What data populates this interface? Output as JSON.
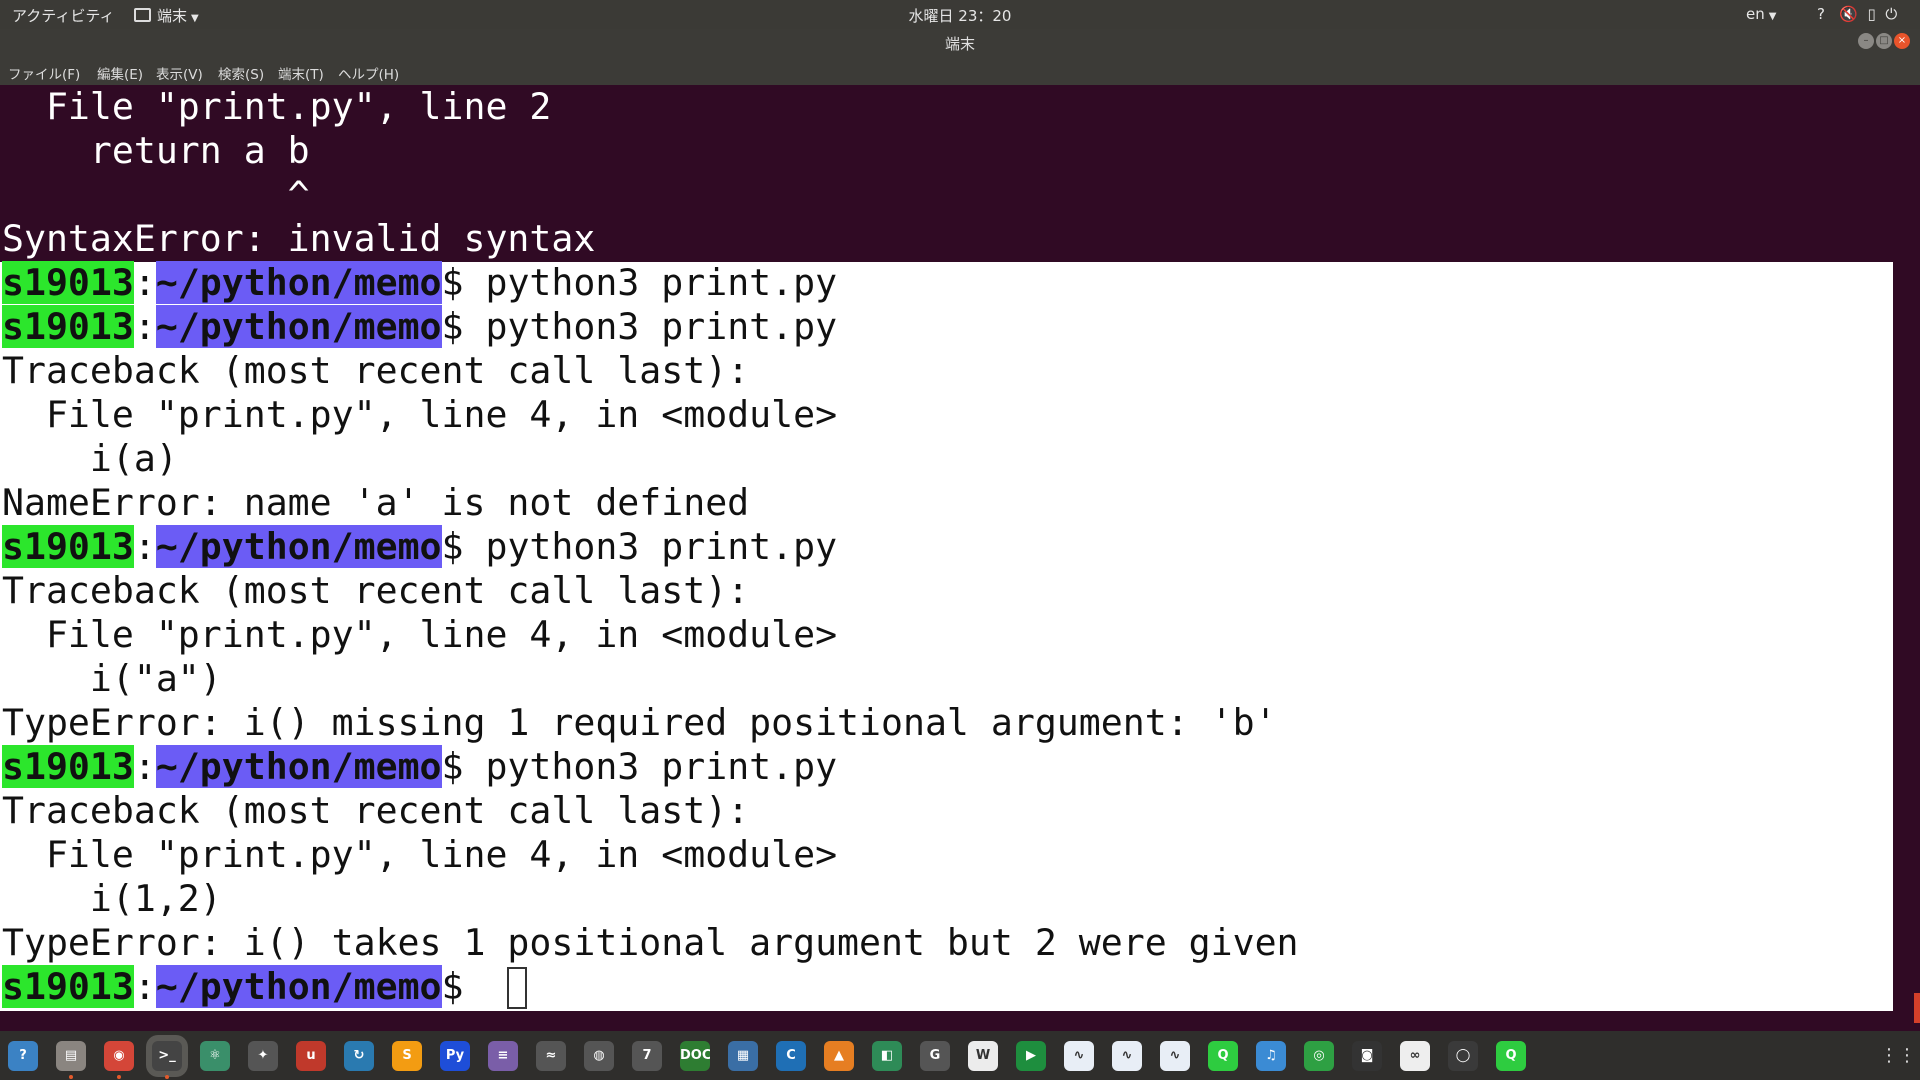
{
  "topbar": {
    "activities": "アクティビティ",
    "app_name": "端末",
    "clock": "水曜日 23：20",
    "language": "en",
    "tray_icons": [
      "help-icon",
      "volume-muted-icon",
      "battery-icon",
      "power-icon"
    ]
  },
  "window": {
    "title": "端末",
    "controls": [
      "minimize",
      "maximize",
      "close"
    ]
  },
  "menu": {
    "file": "ファイル(F)",
    "edit": "編集(E)",
    "view": "表示(V)",
    "search": "検索(S)",
    "terminal": "端末(T)",
    "help": "ヘルプ(H)"
  },
  "terminal": {
    "prompt_user": "s19013",
    "prompt_sep": ":",
    "prompt_path": "~/python/memo",
    "prompt_sign": "$ ",
    "lines": [
      {
        "text": "  File \"print.py\", line 2"
      },
      {
        "text": "    return a b"
      },
      {
        "text": "             ^"
      },
      {
        "text": "SyntaxError: invalid syntax"
      },
      {
        "cmd": "python3 print.py"
      },
      {
        "cmd": "python3 print.py"
      },
      {
        "text": "Traceback (most recent call last):"
      },
      {
        "text": "  File \"print.py\", line 4, in <module>"
      },
      {
        "text": "    i(a)"
      },
      {
        "text": "NameError: name 'a' is not defined"
      },
      {
        "cmd": "python3 print.py"
      },
      {
        "text": "Traceback (most recent call last):"
      },
      {
        "text": "  File \"print.py\", line 4, in <module>"
      },
      {
        "text": "    i(\"a\")"
      },
      {
        "text": "TypeError: i() missing 1 required positional argument: 'b'"
      },
      {
        "cmd": "python3 print.py"
      },
      {
        "text": "Traceback (most recent call last):"
      },
      {
        "text": "  File \"print.py\", line 4, in <module>"
      },
      {
        "text": "    i(1,2)"
      },
      {
        "text": "TypeError: i() takes 1 positional argument but 2 were given"
      },
      {
        "cmd": ""
      }
    ]
  },
  "dock": {
    "apps": [
      {
        "name": "help-app",
        "label": "?",
        "color": "#3b82c4"
      },
      {
        "name": "file-manager-app",
        "label": "▤",
        "color": "#8a8580",
        "running": true
      },
      {
        "name": "chrome-app",
        "label": "◉",
        "color": "#d44638",
        "running": true
      },
      {
        "name": "terminal-app",
        "label": ">_",
        "color": "#444",
        "running": true,
        "active": true
      },
      {
        "name": "atom-app",
        "label": "⚛",
        "color": "#3a8f6a"
      },
      {
        "name": "sourcetree-app",
        "label": "✦",
        "color": "#555"
      },
      {
        "name": "text-app",
        "label": "u",
        "color": "#c0392b"
      },
      {
        "name": "update-app",
        "label": "↻",
        "color": "#2a7ab0"
      },
      {
        "name": "sublime-app",
        "label": "S",
        "color": "#f39c12"
      },
      {
        "name": "pycharm-app",
        "label": "Py",
        "color": "#1e4ed8"
      },
      {
        "name": "notes-app",
        "label": "≡",
        "color": "#7a5ea8"
      },
      {
        "name": "wifi-app",
        "label": "≈",
        "color": "#555"
      },
      {
        "name": "globe-app",
        "label": "◍",
        "color": "#555"
      },
      {
        "name": "editor-app",
        "label": "7",
        "color": "#555"
      },
      {
        "name": "doc-app",
        "label": "DOC",
        "color": "#2e7d32"
      },
      {
        "name": "windows-app",
        "label": "▦",
        "color": "#3a6ea5"
      },
      {
        "name": "c-app",
        "label": "C",
        "color": "#1f6fb5"
      },
      {
        "name": "blocks-app",
        "label": "▲",
        "color": "#e67e22"
      },
      {
        "name": "box-app",
        "label": "◧",
        "color": "#2e8b57"
      },
      {
        "name": "g-app",
        "label": "G",
        "color": "#555"
      },
      {
        "name": "wikipedia-app",
        "label": "W",
        "color": "#ececec"
      },
      {
        "name": "player-app",
        "label": "▶",
        "color": "#1e8e3e"
      },
      {
        "name": "chart1-app",
        "label": "∿",
        "color": "#e8eef6"
      },
      {
        "name": "chart2-app",
        "label": "∿",
        "color": "#e8eef6"
      },
      {
        "name": "chart3-app",
        "label": "∿",
        "color": "#e8eef6"
      },
      {
        "name": "q1-app",
        "label": "Q",
        "color": "#2ecc40"
      },
      {
        "name": "bookmark-app",
        "label": "♫",
        "color": "#3b8bd4"
      },
      {
        "name": "mykey-app",
        "label": "◎",
        "color": "#2ea043"
      },
      {
        "name": "robot-app",
        "label": "◙",
        "color": "#333"
      },
      {
        "name": "link-app",
        "label": "∞",
        "color": "#eee"
      },
      {
        "name": "circle-app",
        "label": "◯",
        "color": "#3a3a3a"
      },
      {
        "name": "q2-app",
        "label": "Q",
        "color": "#2ecc40"
      }
    ]
  }
}
